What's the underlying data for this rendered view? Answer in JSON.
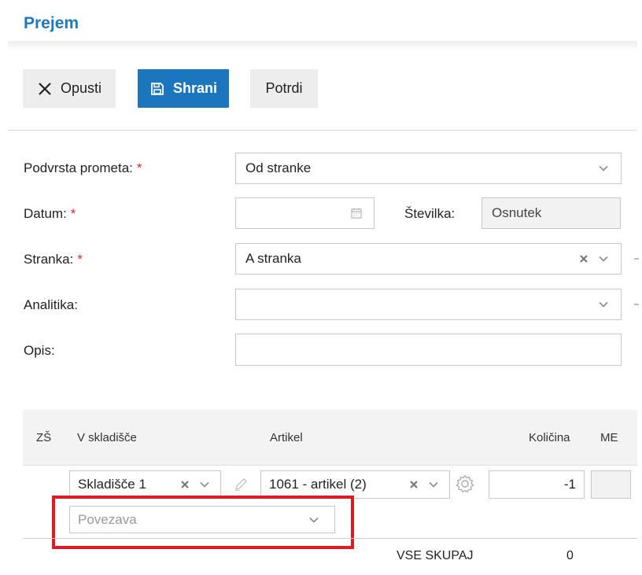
{
  "page": {
    "title": "Prejem"
  },
  "toolbar": {
    "cancel_label": "Opusti",
    "save_label": "Shrani",
    "confirm_label": "Potrdi"
  },
  "form": {
    "podvrsta": {
      "label": "Podvrsta prometa:",
      "required_mark": "*",
      "value": "Od stranke"
    },
    "datum": {
      "label": "Datum:",
      "required_mark": "*",
      "value": ""
    },
    "stevilka": {
      "label": "Številka:",
      "value": "Osnutek"
    },
    "stranka": {
      "label": "Stranka:",
      "required_mark": "*",
      "value": "A stranka"
    },
    "analitika": {
      "label": "Analitika:",
      "value": ""
    },
    "opis": {
      "label": "Opis:",
      "value": ""
    }
  },
  "table": {
    "headers": {
      "zs": "ZŠ",
      "skladisce": "V skladišče",
      "artikel": "Artikel",
      "kolicina": "Količina",
      "me": "ME"
    },
    "rows": [
      {
        "skladisce": "Skladišče 1",
        "artikel": "1061 - artikel (2)",
        "kolicina": "-1",
        "me": "",
        "povezava_placeholder": "Povezava"
      }
    ],
    "total": {
      "label": "VSE SKUPAJ",
      "value": "0"
    }
  },
  "colors": {
    "accent": "#1e79bd",
    "primary_button": "#1c76bd",
    "required": "#d72828",
    "highlight": "#e01a22"
  }
}
